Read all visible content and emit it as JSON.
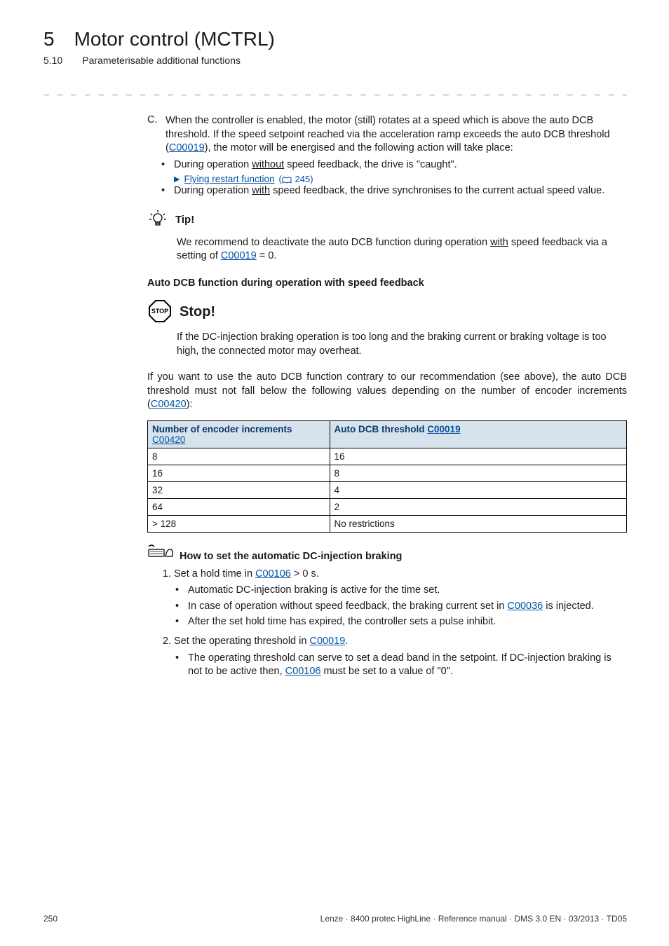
{
  "header": {
    "chapter_num": "5",
    "chapter_title": "Motor control (MCTRL)",
    "section_num": "5.10",
    "section_title": "Parameterisable additional functions"
  },
  "divider": "_ _ _ _ _ _ _ _ _ _ _ _ _ _ _ _ _ _ _ _ _ _ _ _ _ _ _ _ _ _ _ _ _ _ _ _ _ _ _ _ _ _ _ _ _ _ _ _ _ _ _ _ _ _ _ _ _ _ _ _ _ _ _ _",
  "itemC": {
    "letter": "C.",
    "text_before": "When the controller is enabled, the motor (still) rotates at a speed which is above the auto DCB threshold. If the speed setpoint reached via the acceleration ramp exceeds the auto DCB threshold (",
    "link": "C00019",
    "text_after": "), the motor will be energised and the following action will take place:"
  },
  "itemC_bullets": {
    "b1_pre": "During operation ",
    "b1_u": "without",
    "b1_post": " speed feedback, the drive is \"caught\".",
    "fly_link": "Flying restart function",
    "fly_page": "245",
    "b2_pre": "During operation ",
    "b2_u": "with",
    "b2_post": " speed feedback, the drive synchronises to the current actual speed value."
  },
  "tip": {
    "label": "Tip!",
    "text_pre": "We recommend to deactivate the auto DCB function during operation ",
    "text_u": "with",
    "text_mid": " speed feedback via a setting of ",
    "link": "C00019",
    "text_post": " = 0."
  },
  "heading1": "Auto DCB function during operation with speed feedback",
  "stop": {
    "label": "Stop!",
    "text": "If the DC-injection braking operation is too long and the braking current or braking voltage is too high, the connected motor may overheat."
  },
  "para1": {
    "pre": "If you want to use the auto DCB function contrary to our recommendation (see above), the auto DCB threshold must not fall below the following values depending on the number of encoder increments (",
    "link": "C00420",
    "post": "):"
  },
  "table": {
    "h1_line1": "Number of encoder increments",
    "h1_link": "C00420",
    "h2_pre": "Auto DCB threshold ",
    "h2_link": "C00019",
    "rows": [
      {
        "c1": "8",
        "c2": "16"
      },
      {
        "c1": "16",
        "c2": "8"
      },
      {
        "c1": "32",
        "c2": "4"
      },
      {
        "c1": "64",
        "c2": "2"
      },
      {
        "c1": "> 128",
        "c2": "No restrictions"
      }
    ]
  },
  "howto": {
    "label": "How to set the automatic DC-injection braking",
    "step1_pre": "Set a hold time in ",
    "step1_link": "C00106",
    "step1_post": " > 0 s.",
    "s1_b1": "Automatic DC-injection braking is active for the time set.",
    "s1_b2_pre": "In case of operation without speed feedback, the braking current set in ",
    "s1_b2_link": "C00036",
    "s1_b2_post": " is injected.",
    "s1_b3": "After the set hold time has expired, the controller sets a pulse inhibit.",
    "step2_pre": "Set the operating threshold in ",
    "step2_link": "C00019",
    "step2_post": ".",
    "s2_b1_pre": "The operating threshold can serve to set a dead band in the setpoint. If DC-injection braking is not to be active then, ",
    "s2_b1_link": "C00106",
    "s2_b1_post": " must be set to a value of \"0\"."
  },
  "footer": {
    "page": "250",
    "right": "Lenze · 8400 protec HighLine · Reference manual · DMS 3.0 EN · 03/2013 · TD05"
  }
}
